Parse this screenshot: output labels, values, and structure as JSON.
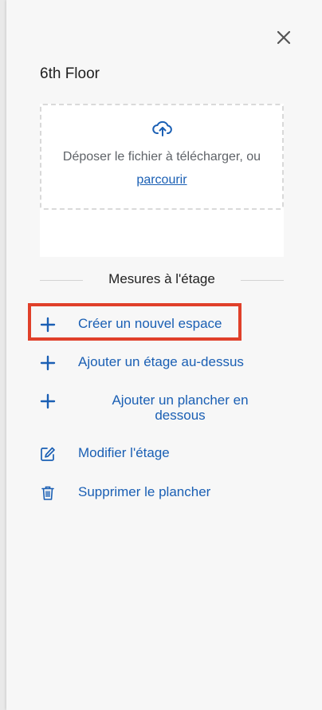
{
  "panel": {
    "title": "6th Floor",
    "close_icon": "close-icon"
  },
  "upload": {
    "icon": "cloud-upload-icon",
    "drop_text": "Déposer le fichier à télécharger, ou",
    "browse_link": "parcourir"
  },
  "section": {
    "title": "Mesures à l'étage"
  },
  "actions": [
    {
      "label": "Créer un nouvel espace",
      "icon": "plus-icon",
      "highlighted": true
    },
    {
      "label": "Ajouter un étage au-dessus",
      "icon": "plus-icon"
    },
    {
      "label_line1": "Ajouter un plancher en",
      "label_line2": "dessous",
      "icon": "plus-icon"
    },
    {
      "label": "Modifier l'étage",
      "icon": "edit-icon"
    },
    {
      "label": "Supprimer le plancher",
      "icon": "trash-icon"
    }
  ],
  "colors": {
    "accent": "#1a5fb4",
    "highlight": "#e0402a"
  }
}
